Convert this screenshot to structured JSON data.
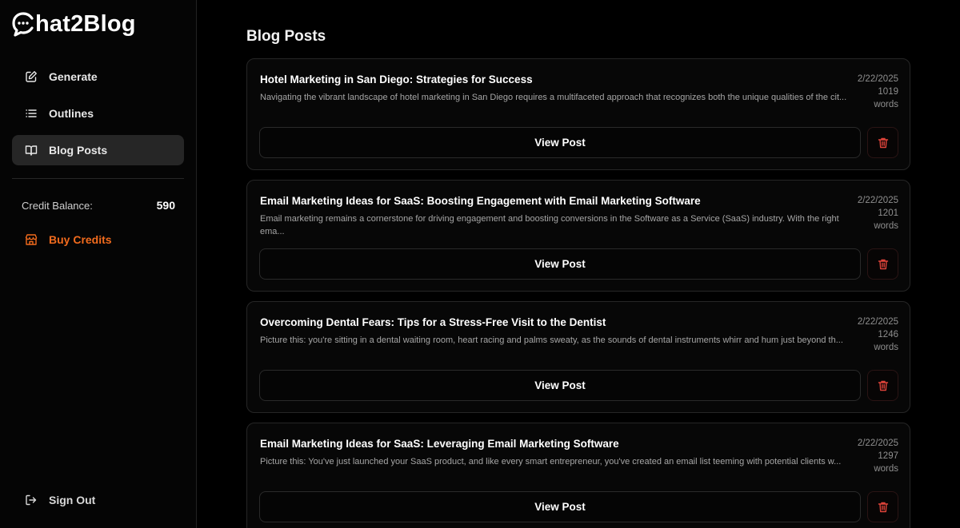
{
  "app": {
    "logo_text": "hat2Blog"
  },
  "sidebar": {
    "items": [
      {
        "label": "Generate",
        "icon": "edit-icon",
        "active": false
      },
      {
        "label": "Outlines",
        "icon": "list-icon",
        "active": false
      },
      {
        "label": "Blog Posts",
        "icon": "book-icon",
        "active": true
      }
    ],
    "credit_label": "Credit Balance:",
    "credit_value": "590",
    "buy_label": "Buy Credits",
    "signout_label": "Sign Out"
  },
  "main": {
    "title": "Blog Posts",
    "posts": [
      {
        "title": "Hotel Marketing in San Diego: Strategies for Success",
        "excerpt": "Navigating the vibrant landscape of hotel marketing in San Diego requires a multifaceted approach that recognizes both the unique qualities of the cit...",
        "date": "2/22/2025",
        "words": "1019",
        "words_label": "words",
        "view_label": "View Post"
      },
      {
        "title": "Email Marketing Ideas for SaaS: Boosting Engagement with Email Marketing Software",
        "excerpt": "Email marketing remains a cornerstone for driving engagement and boosting conversions in the Software as a Service (SaaS) industry. With the right ema...",
        "date": "2/22/2025",
        "words": "1201",
        "words_label": "words",
        "view_label": "View Post"
      },
      {
        "title": "Overcoming Dental Fears: Tips for a Stress-Free Visit to the Dentist",
        "excerpt": "Picture this: you're sitting in a dental waiting room, heart racing and palms sweaty, as the sounds of dental instruments whirr and hum just beyond th...",
        "date": "2/22/2025",
        "words": "1246",
        "words_label": "words",
        "view_label": "View Post"
      },
      {
        "title": "Email Marketing Ideas for SaaS: Leveraging Email Marketing Software",
        "excerpt": "Picture this: You've just launched your SaaS product, and like every smart entrepreneur, you've created an email list teeming with potential clients w...",
        "date": "2/22/2025",
        "words": "1297",
        "words_label": "words",
        "view_label": "View Post"
      }
    ]
  },
  "colors": {
    "accent": "#f26b1d",
    "danger": "#e0443a",
    "background": "#000000",
    "active_nav": "#262626"
  }
}
